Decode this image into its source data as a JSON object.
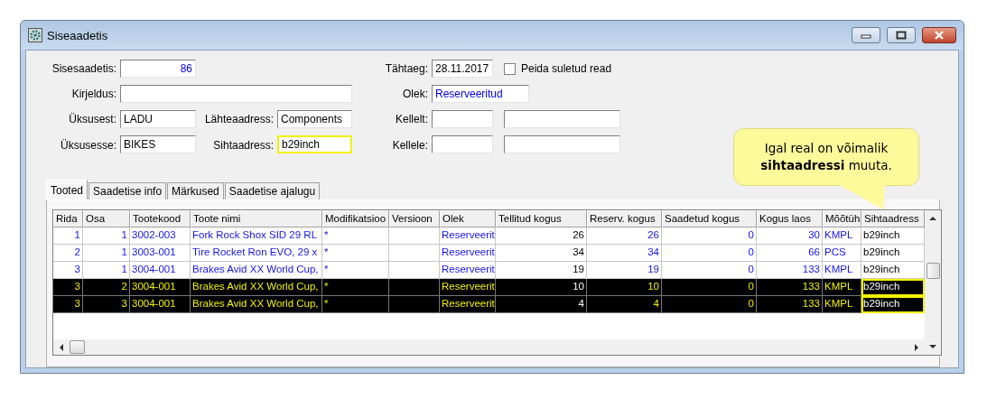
{
  "window": {
    "title": "Siseaadetis"
  },
  "form": {
    "fields": [
      {
        "label": "Sisesaadetis:",
        "value": "86",
        "emphasis": true
      },
      {
        "label": "Kirjeldus:"
      },
      {
        "label": "Üksusest:",
        "value": "LADU",
        "emphasis": false
      },
      {
        "label": "Lähteaadress:",
        "value": "Components",
        "emphasis": false
      },
      {
        "label": "Üksusesse:",
        "value": "BIKES",
        "emphasis": false
      },
      {
        "label": "Sihtaadress:",
        "value": "b29inch",
        "emphasis": false,
        "highlighted": true
      },
      {
        "label": "Tähtaeg:",
        "value": "28.11.2017",
        "emphasis": false
      },
      {
        "label": "Olek:",
        "value": "Reserveeritud",
        "emphasis": true
      },
      {
        "label": "Kellelt:",
        "second": true
      },
      {
        "label": "Kellele:",
        "second": true
      }
    ],
    "checkbox": {
      "label": "Peida suletud read",
      "checked": false
    }
  },
  "tabs": [
    {
      "label": "Tooted",
      "selected": true
    },
    {
      "label": "Saadetise info",
      "selected": false
    },
    {
      "label": "Märkused",
      "selected": false
    },
    {
      "label": "Saadetise ajalugu",
      "selected": false
    }
  ],
  "table": {
    "columns": [
      {
        "label": "Rida",
        "emphasis": true
      },
      {
        "label": "Osa",
        "emphasis": true
      },
      {
        "label": "Tootekood",
        "emphasis": true
      },
      {
        "label": "Toote nimi",
        "emphasis": true
      },
      {
        "label": "Modifikatsioo",
        "emphasis": true
      },
      {
        "label": "Versioon"
      },
      {
        "label": "Olek",
        "emphasis": true
      },
      {
        "label": "Tellitud kogus",
        "emphasis": false
      },
      {
        "label": "Reserv. kogus",
        "emphasis": true
      },
      {
        "label": "Saadetud kogus",
        "emphasis": true
      },
      {
        "label": "Kogus laos",
        "emphasis": true
      },
      {
        "label": "Mõõtüh",
        "emphasis": true
      },
      {
        "label": "Sihtaadress",
        "emphasis": false
      }
    ],
    "rows": [
      {
        "selected": false,
        "target_highlighted": false,
        "cells": [
          "1",
          "1",
          "3002-003",
          "Fork Rock Shox SID 29 RL",
          "*",
          null,
          "Reserveerit",
          "26",
          "26",
          "0",
          "30",
          "KMPL",
          "b29inch"
        ]
      },
      {
        "selected": false,
        "target_highlighted": false,
        "cells": [
          "2",
          "1",
          "3003-001",
          "Tire Rocket Ron EVO, 29 x",
          "*",
          null,
          "Reserveerit",
          "34",
          "34",
          "0",
          "66",
          "PCS",
          "b29inch"
        ]
      },
      {
        "selected": false,
        "target_highlighted": false,
        "cells": [
          "3",
          "1",
          "3004-001",
          "Brakes Avid XX World Cup,",
          "*",
          null,
          "Reserveerit",
          "19",
          "19",
          "0",
          "133",
          "KMPL",
          "b29inch"
        ]
      },
      {
        "selected": true,
        "target_highlighted": true,
        "cells": [
          "3",
          "2",
          "3004-001",
          "Brakes Avid XX World Cup,",
          "*",
          null,
          "Reserveerit",
          "10",
          "10",
          "0",
          "133",
          "KMPL",
          "b29inch"
        ]
      },
      {
        "selected": true,
        "target_highlighted": true,
        "cells": [
          "3",
          "3",
          "3004-001",
          "Brakes Avid XX World Cup,",
          "*",
          null,
          "Reserveerit",
          "4",
          "4",
          "0",
          "133",
          "KMPL",
          "b29inch"
        ]
      }
    ]
  },
  "callout": {
    "text": "Igal real on võimalik **sihtaadressi** muuta."
  }
}
